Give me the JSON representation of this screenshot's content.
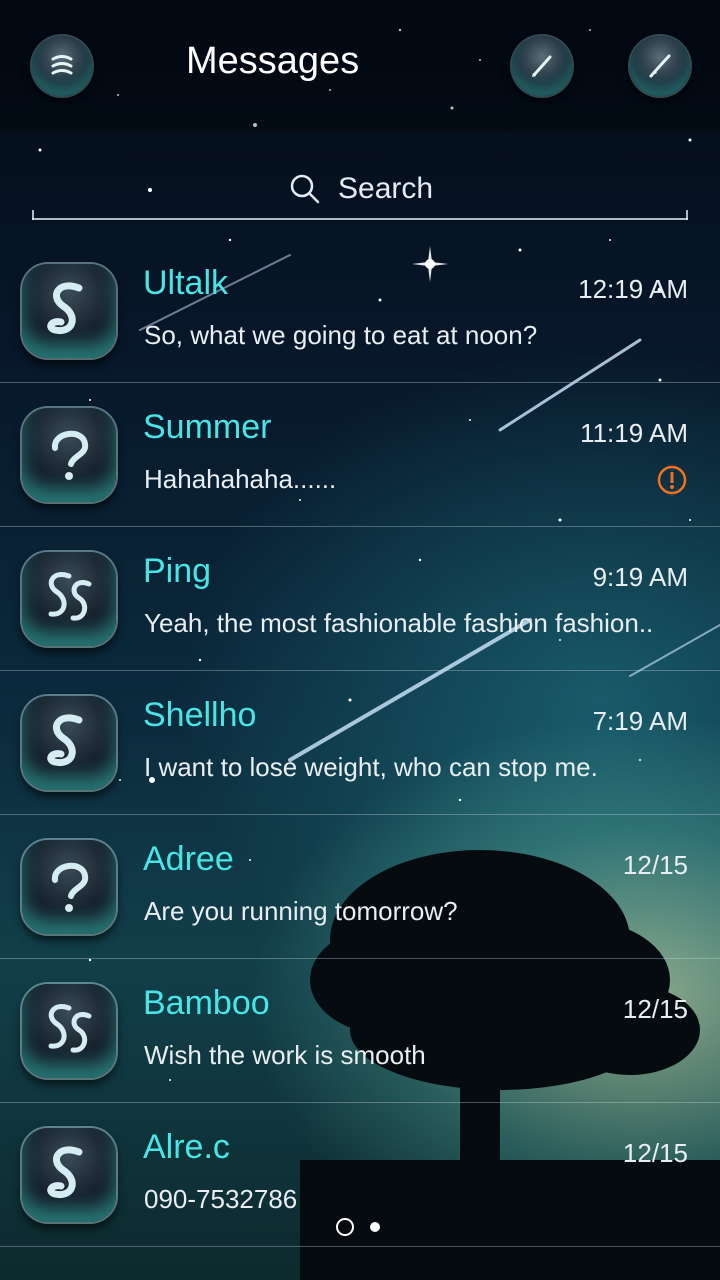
{
  "header": {
    "title": "Messages",
    "menu_icon": "menu-icon",
    "compose_icon": "compose-icon",
    "edit_icon": "edit-icon"
  },
  "search": {
    "placeholder": "Search",
    "icon": "search-icon"
  },
  "conversations": [
    {
      "name": "Ultalk",
      "time": "12:19 AM",
      "preview": "So, what we going to eat at noon?",
      "avatar_icon": "contact-s-icon",
      "alert": false
    },
    {
      "name": "Summer",
      "time": "11:19 AM",
      "preview": "Hahahahaha......",
      "avatar_icon": "unknown-contact-icon",
      "alert": true
    },
    {
      "name": "Ping",
      "time": "9:19 AM",
      "preview": "Yeah, the most fashionable fashion fashion..",
      "avatar_icon": "group-contact-icon",
      "alert": false
    },
    {
      "name": "Shellho",
      "time": "7:19 AM",
      "preview": "I want to lose weight, who can stop me.",
      "avatar_icon": "contact-s-icon",
      "alert": false
    },
    {
      "name": "Adree",
      "time": "12/15",
      "preview": "Are you running tomorrow?",
      "avatar_icon": "unknown-contact-icon",
      "alert": false
    },
    {
      "name": "Bamboo",
      "time": "12/15",
      "preview": "Wish the work is smooth",
      "avatar_icon": "group-contact-icon",
      "alert": false
    },
    {
      "name": "Alre.c",
      "time": "12/15",
      "preview": "090-7532786",
      "avatar_icon": "contact-s-icon",
      "alert": false
    }
  ],
  "pager": {
    "pages": 2,
    "current": 2
  },
  "colors": {
    "name": "#47e6e6",
    "alert": "#f0701e"
  }
}
